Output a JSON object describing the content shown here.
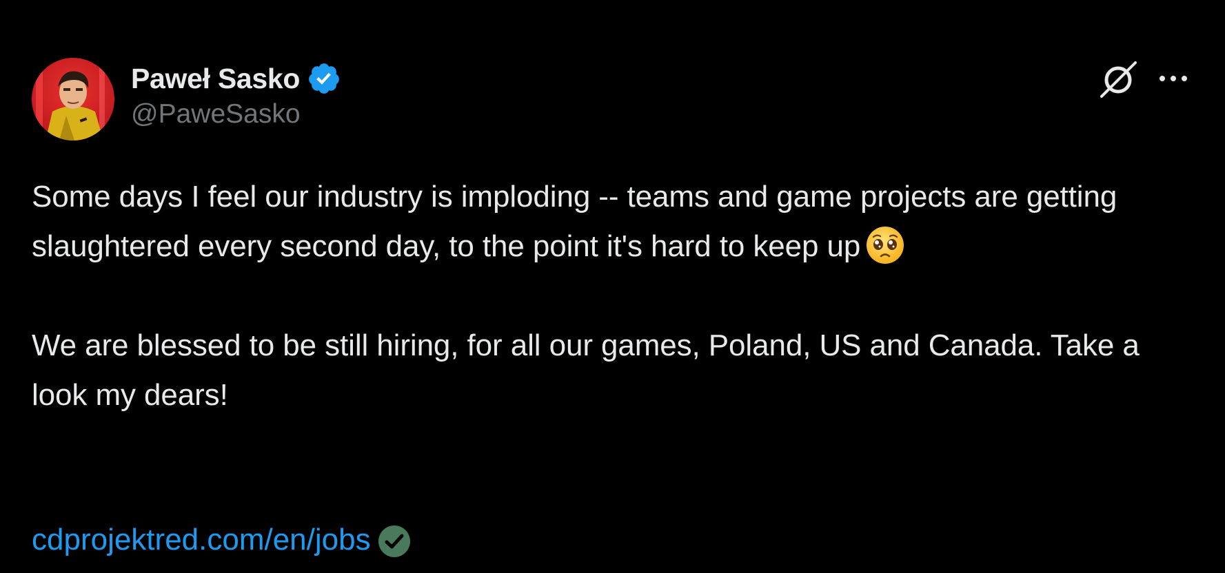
{
  "author": {
    "display_name": "Paweł Sasko",
    "handle": "@PaweSasko",
    "verified": true,
    "verified_color": "#1d9bf0"
  },
  "actions": {
    "grok_icon": "grok-icon",
    "more_icon": "more-icon"
  },
  "tweet": {
    "paragraph_1": "Some days I feel our industry is imploding -- teams and game projects are getting slaughtered every second day, to the point it's hard to keep up",
    "paragraph_1_emoji": "pleading-face-emoji",
    "paragraph_2": "We are blessed to be still hiring, for all our games, Poland, US and Canada. Take a look my dears!",
    "link_text": "cdprojektred.com/en/jobs",
    "link_icon": "check-circle-icon"
  },
  "colors": {
    "background": "#000000",
    "text": "#e7e9ea",
    "secondary_text": "#71767b",
    "link": "#1d9bf0",
    "check_badge": "#4a7a5c"
  }
}
